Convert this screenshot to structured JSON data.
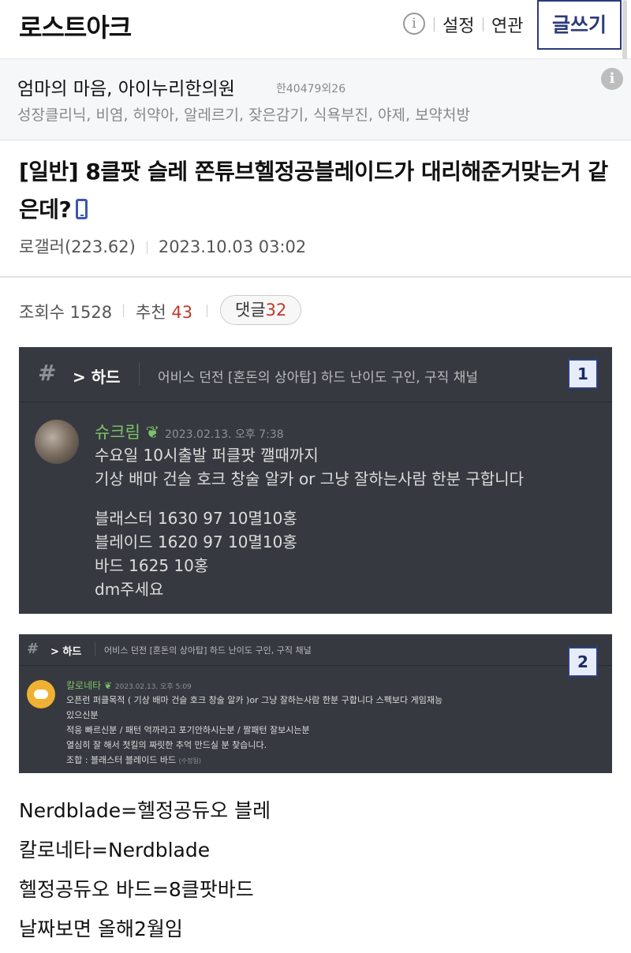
{
  "header": {
    "title": "로스트아크",
    "info_glyph": "i",
    "settings_label": "설정",
    "related_label": "연관",
    "write_label": "글쓰기"
  },
  "ad": {
    "title": "엄마의 마음, 아이누리한의원",
    "code": "한40479외26",
    "description": "성장클리닉, 비염, 허약아, 알레르기, 잦은감기, 식욕부진, 야제, 보약처방",
    "info_glyph": "i"
  },
  "post": {
    "title": "[일반] 8클팟 슬레 쫀튜브헬정공블레이드가 대리해준거맞는거 같은데?",
    "author": "로갤러(223.62)",
    "date": "2023.10.03 03:02"
  },
  "stats": {
    "views_label": "조회수",
    "views": "1528",
    "recommend_label": "추천",
    "recommend": "43",
    "comments_label": "댓글",
    "comments": "32"
  },
  "screenshot1": {
    "hash_glyph": "#",
    "channel": "> 하드",
    "topic": "어비스 던전 [혼돈의 상아탑] 하드 난이도 구인, 구직 채널",
    "badge": "1",
    "username": "슈크림",
    "timestamp": "2023.02.13. 오후 7:38",
    "lines": [
      "수요일 10시출발 퍼클팟 깰때까지",
      "기상 배마 건슬 호크 창술 알카 or 그냥 잘하는사람  한분 구합니다",
      "",
      "블래스터 1630 97 10멸10홍",
      "블레이드 1620 97 10멸10홍",
      "바드 1625 10홍",
      "dm주세요"
    ]
  },
  "screenshot2": {
    "hash_glyph": "#",
    "channel": "> 하드",
    "topic": "어비스 던전 [혼돈의 상아탑] 하드 난이도 구인, 구직 채널",
    "badge": "2",
    "username": "칼로네타",
    "timestamp": "2023.02.13. 오후 5:09",
    "lines": [
      "오픈런 퍼클목적 ( 기상 배마 건슬 호크 창술 알카 )or 그냥 잘하는사람  한분 구합니다  스펙보다 게임재능",
      "있으신분",
      "적응 빠르신분 / 패턴 억까라고 포기안하시는분 / 짤패턴 잘보시는분",
      "열심히 잘 해서 첫킬의 짜릿한 추억 만드실 분 찾습니다.",
      "조합 : 블래스터 블레이드 바드"
    ],
    "edited": "(수정됨)"
  },
  "body_lines": [
    "Nerdblade=헬정공듀오 블레",
    "칼로네타=Nerdblade",
    "헬정공듀오 바드=8클팟바드",
    "날짜보면 올해2월임"
  ]
}
